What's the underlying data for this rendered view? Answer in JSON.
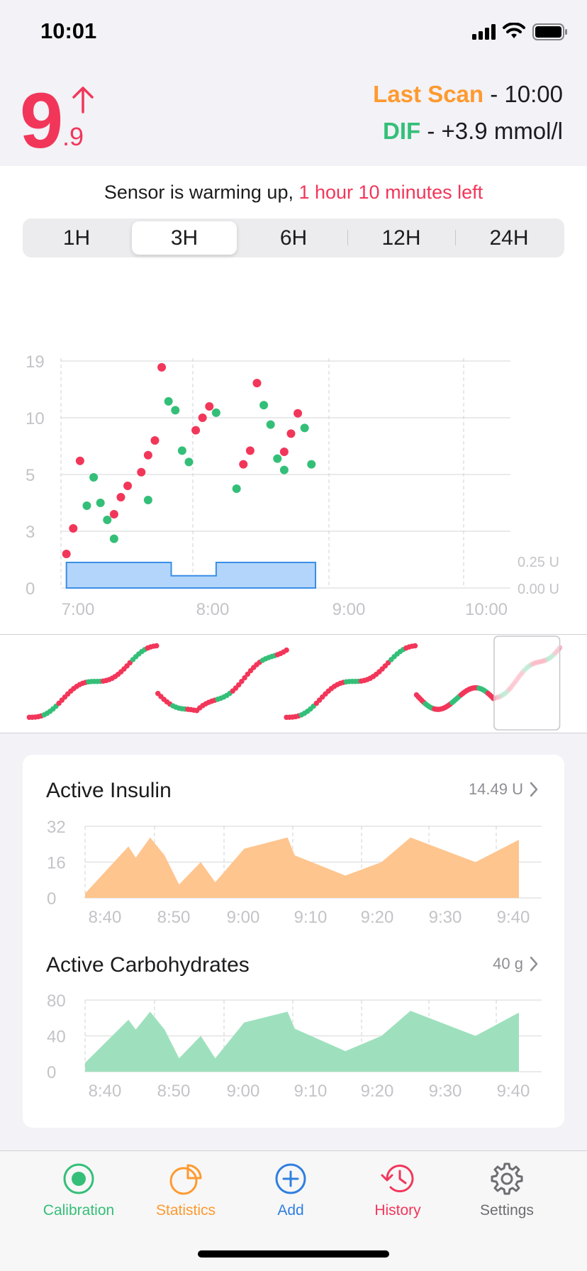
{
  "status_bar": {
    "time": "10:01"
  },
  "header": {
    "glucose_integer": "9",
    "glucose_decimal": ".9",
    "trend": "rising",
    "last_scan_label": "Last Scan",
    "last_scan_time": "- 10:00",
    "dif_label": "DIF",
    "dif_value": "- +3.9 mmol/l"
  },
  "sensor_status": {
    "message": "Sensor is warming up,",
    "time_left": "1 hour 10 minutes left"
  },
  "range_selector": {
    "options": [
      "1H",
      "3H",
      "6H",
      "12H",
      "24H"
    ],
    "selected": "3H"
  },
  "glucose_chart": {
    "y_ticks": [
      "19",
      "10",
      "5",
      "3",
      "0"
    ],
    "x_ticks": [
      "7:00",
      "8:00",
      "9:00",
      "10:00"
    ],
    "insulin_ticks": [
      "0.25 U",
      "0.00 U"
    ]
  },
  "active_insulin": {
    "title": "Active Insulin",
    "value": "14.49 U",
    "y_ticks": [
      "32",
      "16",
      "0"
    ],
    "x_ticks": [
      "8:40",
      "8:50",
      "9:00",
      "9:10",
      "9:20",
      "9:30",
      "9:40"
    ]
  },
  "active_carbs": {
    "title": "Active Carbohydrates",
    "value": "40 g",
    "y_ticks": [
      "80",
      "40",
      "0"
    ],
    "x_ticks": [
      "8:40",
      "8:50",
      "9:00",
      "9:10",
      "9:20",
      "9:30",
      "9:40"
    ]
  },
  "tab_bar": {
    "items": [
      {
        "label": "Calibration",
        "icon": "calibration-icon",
        "color": "#34bf78"
      },
      {
        "label": "Statistics",
        "icon": "statistics-icon",
        "color": "#fe9a2f"
      },
      {
        "label": "Add",
        "icon": "add-icon",
        "color": "#2f7fe0"
      },
      {
        "label": "History",
        "icon": "history-icon",
        "color": "#f2365a"
      },
      {
        "label": "Settings",
        "icon": "settings-icon",
        "color": "#6d6d72"
      }
    ]
  },
  "colors": {
    "high": "#f2365a",
    "normal": "#34bf78",
    "insulin_fill": "#fec58e",
    "carbs_fill": "#9ee0bd",
    "basal_fill": "#b3d5fb",
    "basal_stroke": "#3a8ee6"
  },
  "chart_data": [
    {
      "type": "scatter",
      "title": "",
      "xlabel": "",
      "ylabel": "",
      "x_ticks": [
        "7:00",
        "8:00",
        "9:00",
        "10:00"
      ],
      "y_ticks": [
        0,
        3,
        5,
        10,
        19
      ],
      "y_scale": "nonlinear",
      "ylim": [
        0,
        19
      ],
      "series": [
        {
          "color": "#f2365a",
          "points": [
            [
              "6:55",
              1.8
            ],
            [
              "7:00",
              3.1
            ],
            [
              "7:05",
              6.2
            ],
            [
              "7:30",
              3.6
            ],
            [
              "7:35",
              4.2
            ],
            [
              "7:40",
              4.6
            ],
            [
              "7:50",
              5.2
            ],
            [
              "7:55",
              6.7
            ],
            [
              "8:00",
              8.0
            ],
            [
              "8:05",
              18.0
            ],
            [
              "8:30",
              8.9
            ],
            [
              "8:35",
              10.0
            ],
            [
              "8:40",
              11.8
            ],
            [
              "9:05",
              5.9
            ],
            [
              "9:10",
              7.1
            ],
            [
              "9:15",
              15.5
            ],
            [
              "9:35",
              7.0
            ],
            [
              "9:40",
              8.6
            ],
            [
              "9:45",
              10.7
            ]
          ]
        },
        {
          "color": "#34bf78",
          "points": [
            [
              "7:10",
              3.9
            ],
            [
              "7:15",
              4.9
            ],
            [
              "7:20",
              4.0
            ],
            [
              "7:25",
              3.4
            ],
            [
              "7:30",
              2.6
            ],
            [
              "7:55",
              4.1
            ],
            [
              "8:10",
              12.6
            ],
            [
              "8:15",
              11.2
            ],
            [
              "8:20",
              7.1
            ],
            [
              "8:25",
              6.1
            ],
            [
              "8:45",
              10.8
            ],
            [
              "9:00",
              4.5
            ],
            [
              "9:20",
              12.0
            ],
            [
              "9:25",
              9.4
            ],
            [
              "9:30",
              6.4
            ],
            [
              "9:35",
              5.4
            ],
            [
              "9:50",
              9.1
            ],
            [
              "9:55",
              5.9
            ]
          ]
        }
      ],
      "basal_insulin": {
        "ticks": [
          "0.25 U",
          "0.00 U"
        ],
        "segments": [
          [
            "6:55",
            "8:12",
            0.25
          ],
          [
            "8:12",
            "8:45",
            0.12
          ],
          [
            "8:45",
            "9:58",
            0.25
          ]
        ]
      }
    },
    {
      "type": "area",
      "title": "Active Insulin",
      "x_ticks": [
        "8:40",
        "8:50",
        "9:00",
        "9:10",
        "9:20",
        "9:30",
        "9:40"
      ],
      "ylim": [
        0,
        32
      ],
      "x": [
        "8:40",
        "8:46",
        "8:47",
        "8:49",
        "8:51",
        "8:53",
        "8:56",
        "8:58",
        "9:02",
        "9:08",
        "9:09",
        "9:16",
        "9:21",
        "9:25",
        "9:34",
        "9:40"
      ],
      "values": [
        2,
        23,
        18,
        27,
        19,
        6,
        16,
        7,
        22,
        27,
        19,
        10,
        16,
        27,
        16,
        26
      ]
    },
    {
      "type": "area",
      "title": "Active Carbohydrates",
      "x_ticks": [
        "8:40",
        "8:50",
        "9:00",
        "9:10",
        "9:20",
        "9:30",
        "9:40"
      ],
      "ylim": [
        0,
        80
      ],
      "x": [
        "8:40",
        "8:46",
        "8:47",
        "8:49",
        "8:51",
        "8:53",
        "8:56",
        "8:58",
        "9:02",
        "9:08",
        "9:09",
        "9:16",
        "9:21",
        "9:25",
        "9:34",
        "9:40"
      ],
      "values": [
        10,
        58,
        47,
        67,
        47,
        15,
        40,
        15,
        55,
        67,
        48,
        23,
        40,
        68,
        40,
        66
      ]
    }
  ]
}
